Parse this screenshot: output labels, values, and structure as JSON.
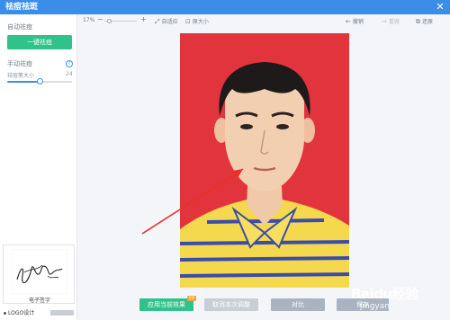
{
  "window": {
    "title": "祛痘祛斑",
    "close_glyph": "✕"
  },
  "sidebar": {
    "auto_label": "自动祛痘",
    "one_key_button": "一键祛痘",
    "manual_label": "手动祛痘",
    "help_glyph": "?",
    "brush_size_label": "祛痘笔大小",
    "brush_size_value": "24",
    "brush_size_level": 0.5,
    "signature_caption": "电子签字",
    "logo_design_label": "LOGO设计"
  },
  "toolbar": {
    "zoom_percent": "17%",
    "zoom_minus": "−",
    "zoom_plus": "+",
    "fit_label": "自适应",
    "original_size_label": "原大小",
    "undo_label": "撤销",
    "redo_label": "重做",
    "restore_label": "还原"
  },
  "bottombar": {
    "apply_label": "应用当前效果",
    "cancel_label": "取消本次调整",
    "compare_label": "对比",
    "save_label": "保存",
    "vip_badge": "VIP"
  },
  "watermark": {
    "text": "Baidu经验",
    "sub": "jingyan"
  },
  "colors": {
    "titlebar": "#3b8ee8",
    "accent_green": "#2fc28a",
    "photo_background": "#e2343d",
    "arrow": "#e8302a"
  },
  "icons": {
    "fit": "fit-screen-icon",
    "original_size": "original-size-icon",
    "undo": "undo-icon",
    "redo": "redo-icon",
    "restore": "restore-icon",
    "help": "help-icon",
    "close": "close-icon"
  }
}
